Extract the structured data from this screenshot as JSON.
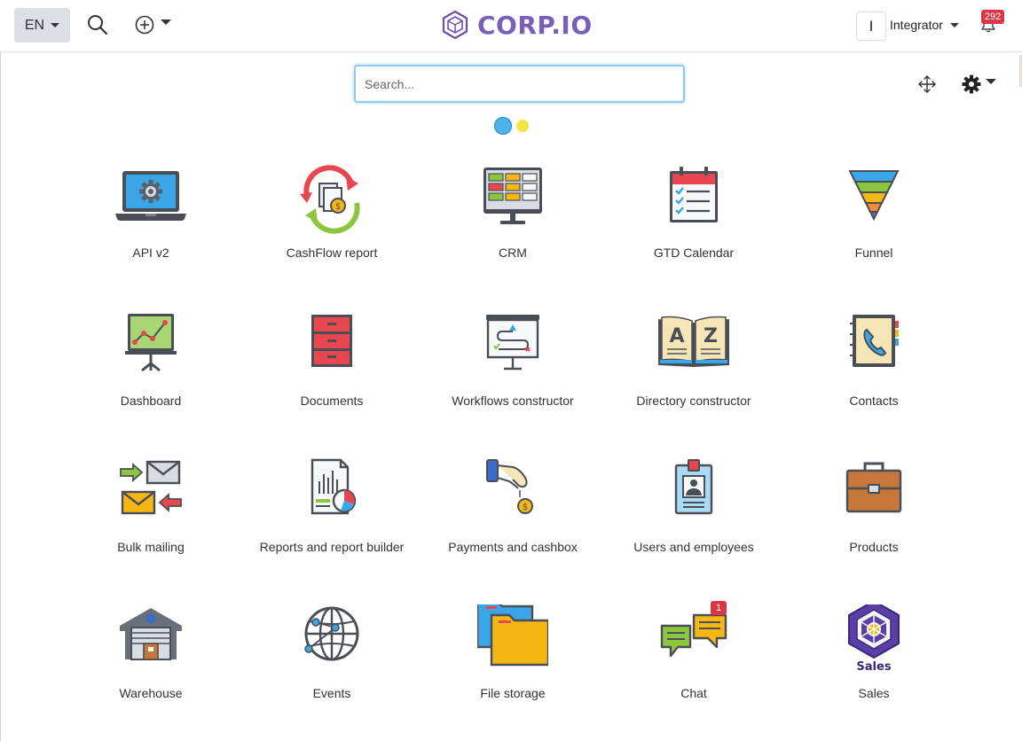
{
  "header": {
    "language": "EN",
    "logo_text": "CORP.IO",
    "avatar_initial": "I",
    "user_name": "Integrator",
    "notification_count": "292"
  },
  "search": {
    "placeholder": "Search..."
  },
  "colors": {
    "accent": "#7a5fb8",
    "badge": "#dc3545",
    "search_border": "#8fc9ee"
  },
  "apps": [
    {
      "label": "API v2",
      "icon": "laptop-gear-icon"
    },
    {
      "label": "CashFlow report",
      "icon": "cashflow-cycle-icon"
    },
    {
      "label": "CRM",
      "icon": "crm-monitor-icon"
    },
    {
      "label": "GTD Calendar",
      "icon": "calendar-checklist-icon"
    },
    {
      "label": "Funnel",
      "icon": "funnel-icon"
    },
    {
      "label": "Dashboard",
      "icon": "dashboard-chart-icon"
    },
    {
      "label": "Documents",
      "icon": "filing-cabinet-icon"
    },
    {
      "label": "Workflows constructor",
      "icon": "workflow-board-icon"
    },
    {
      "label": "Directory constructor",
      "icon": "az-book-icon"
    },
    {
      "label": "Contacts",
      "icon": "phone-book-icon"
    },
    {
      "label": "Bulk mailing",
      "icon": "envelopes-icon"
    },
    {
      "label": "Reports and report builder",
      "icon": "report-chart-icon"
    },
    {
      "label": "Payments and cashbox",
      "icon": "hand-coin-icon"
    },
    {
      "label": "Users and employees",
      "icon": "id-badge-icon"
    },
    {
      "label": "Products",
      "icon": "briefcase-icon"
    },
    {
      "label": "Warehouse",
      "icon": "warehouse-icon"
    },
    {
      "label": "Events",
      "icon": "globe-network-icon"
    },
    {
      "label": "File storage",
      "icon": "folders-icon"
    },
    {
      "label": "Chat",
      "icon": "chat-bubbles-icon",
      "badge": "1"
    },
    {
      "label": "Sales",
      "icon": "sales-logo-icon",
      "icon_text": "Sales"
    }
  ]
}
